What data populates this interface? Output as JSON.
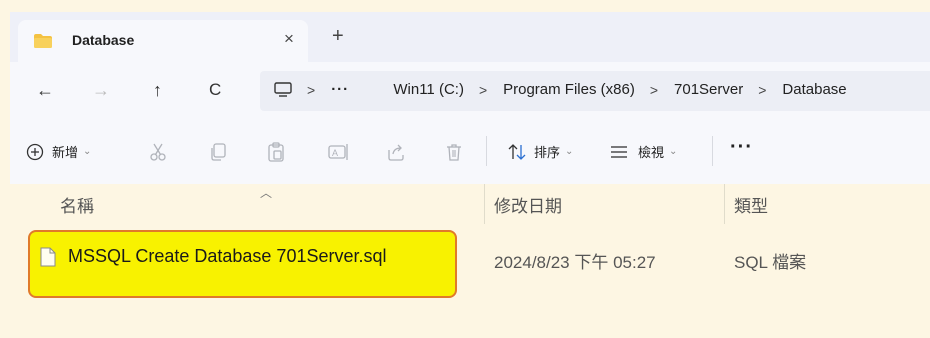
{
  "tab": {
    "title": "Database",
    "close_glyph": "×",
    "new_tab_glyph": "+"
  },
  "nav": {
    "back_glyph": "←",
    "forward_glyph": "→",
    "up_glyph": "↑",
    "refresh_glyph": "C",
    "breadcrumb_overflow": "···",
    "breadcrumbs": [
      "Win11 (C:)",
      "Program Files (x86)",
      "701Server",
      "Database"
    ],
    "separator": ">"
  },
  "toolbar": {
    "new_label": "新增",
    "new_chevron": "⌄",
    "sort_label": "排序",
    "view_label": "檢視",
    "more_glyph": "···"
  },
  "columns": {
    "name": "名稱",
    "modified": "修改日期",
    "type": "類型"
  },
  "files": [
    {
      "name": "MSSQL Create Database 701Server.sql",
      "modified": "2024/8/23 下午 05:27",
      "type": "SQL 檔案",
      "highlighted": true
    }
  ],
  "colors": {
    "highlight_fill": "#f8f200",
    "highlight_border": "#e07a2a",
    "page_bg": "#fdf6e3"
  }
}
